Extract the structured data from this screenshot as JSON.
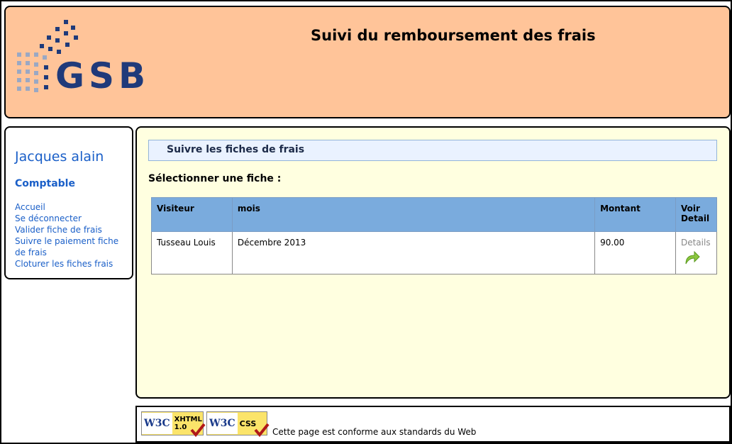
{
  "header": {
    "title": "Suivi du remboursement des frais",
    "logo_text": "GSB"
  },
  "sidebar": {
    "user_name": "Jacques alain",
    "user_role": "Comptable",
    "menu": [
      {
        "label": "Accueil"
      },
      {
        "label": "Se déconnecter"
      },
      {
        "label": "Valider fiche de frais"
      },
      {
        "label": "Suivre le paiement fiche de frais"
      },
      {
        "label": "Cloturer les fiches frais"
      }
    ]
  },
  "main": {
    "section_title": "Suivre les fiches de frais",
    "select_label": "Sélectionner une fiche :",
    "table": {
      "headers": [
        "Visiteur",
        "mois",
        "Montant",
        "Voir Detail"
      ],
      "rows": [
        {
          "visiteur": "Tusseau Louis",
          "mois": "Décembre 2013",
          "montant": "90.00",
          "detail_label": "Details"
        }
      ]
    }
  },
  "footer": {
    "badges": [
      {
        "w3c": "W3C",
        "label_line1": "XHTML",
        "label_line2": "1.0"
      },
      {
        "w3c": "W3C",
        "label_line1": "CSS",
        "label_line2": ""
      }
    ],
    "text": "Cette page est conforme aux standards du Web"
  },
  "colors": {
    "header_bg": "#ffc499",
    "main_bg": "#ffffe0",
    "table_header_bg": "#7aabdd",
    "link_blue": "#1a5fc8",
    "logo_blue": "#1f3a7a"
  },
  "icons": {
    "details": "curved-arrow-icon",
    "badge_check": "checkmark-icon"
  }
}
